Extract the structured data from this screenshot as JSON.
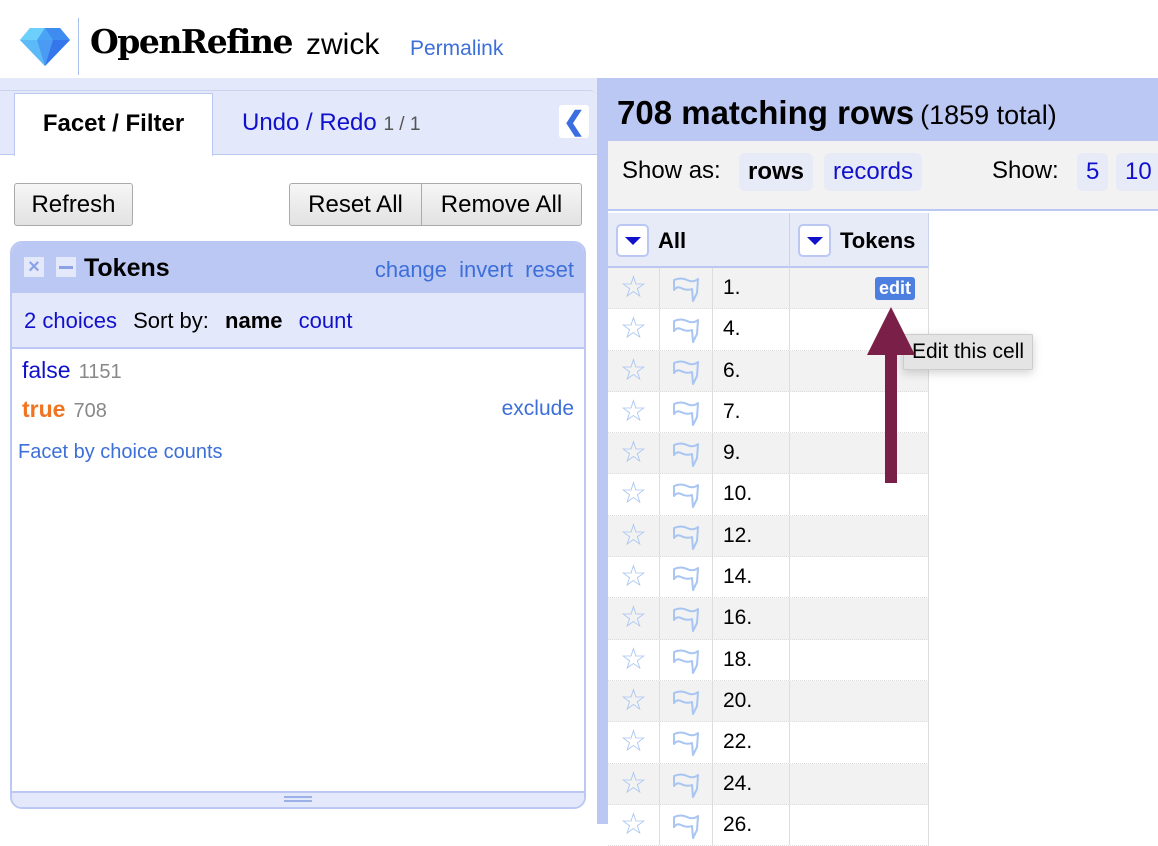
{
  "header": {
    "app_name": "OpenRefine",
    "project_name": "zwick",
    "permalink": "Permalink"
  },
  "left_panel": {
    "tabs": [
      {
        "label": "Facet / Filter",
        "active": true
      },
      {
        "label": "Undo / Redo",
        "count": "1 / 1",
        "active": false
      }
    ],
    "collapse_icon": "chevron-left-icon",
    "buttons": {
      "refresh": "Refresh",
      "reset_all": "Reset All",
      "remove_all": "Remove All"
    },
    "facet": {
      "title": "Tokens",
      "actions": [
        "change",
        "invert",
        "reset"
      ],
      "choices_count": "2 choices",
      "sort_label": "Sort by:",
      "sort_options": [
        "name",
        "count"
      ],
      "sort_selected": "name",
      "choices": [
        {
          "name": "false",
          "count": "1151",
          "selected": false
        },
        {
          "name": "true",
          "count": "708",
          "selected": true,
          "action": "exclude"
        }
      ],
      "facet_by_counts": "Facet by choice counts"
    }
  },
  "right_panel": {
    "summary": {
      "matching": "708 matching rows",
      "total": "(1859 total)"
    },
    "view": {
      "show_as_label": "Show as:",
      "modes": [
        "rows",
        "records"
      ],
      "mode_selected": "rows",
      "show_label": "Show:",
      "page_sizes": [
        "5",
        "10"
      ]
    },
    "columns": [
      {
        "label": "All"
      },
      {
        "label": "Tokens"
      }
    ],
    "rows": [
      {
        "num": "1.",
        "value": "",
        "edit": "edit"
      },
      {
        "num": "4.",
        "value": ""
      },
      {
        "num": "6.",
        "value": ""
      },
      {
        "num": "7.",
        "value": ""
      },
      {
        "num": "9.",
        "value": ""
      },
      {
        "num": "10.",
        "value": ""
      },
      {
        "num": "12.",
        "value": ""
      },
      {
        "num": "14.",
        "value": ""
      },
      {
        "num": "16.",
        "value": ""
      },
      {
        "num": "18.",
        "value": ""
      },
      {
        "num": "20.",
        "value": ""
      },
      {
        "num": "22.",
        "value": ""
      },
      {
        "num": "24.",
        "value": ""
      },
      {
        "num": "26.",
        "value": ""
      }
    ]
  },
  "tooltip": "Edit this cell",
  "colors": {
    "accent_blue": "#bcc8f4",
    "link_blue": "#1111cc",
    "selected_orange": "#f07422",
    "arrow": "#7a1f47",
    "edit_button": "#4c7fe0"
  }
}
